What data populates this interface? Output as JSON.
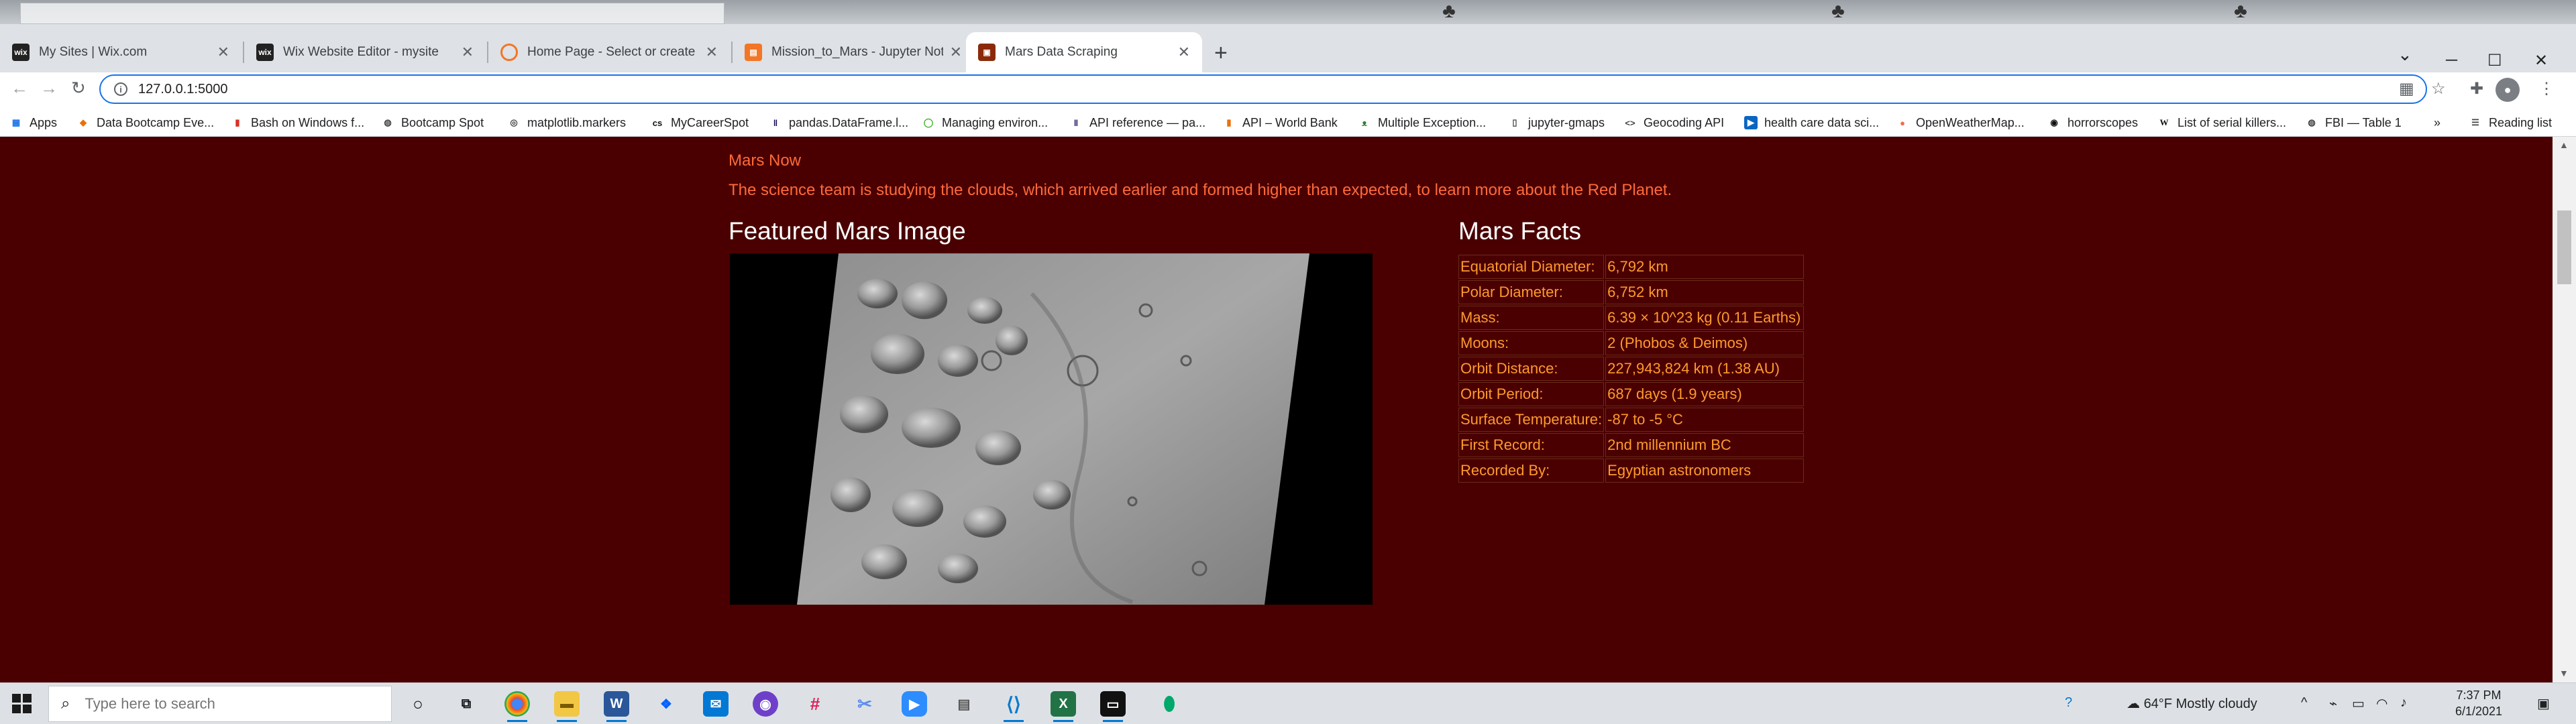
{
  "window": {
    "tabs": [
      {
        "label": "My Sites | Wix.com",
        "icon": "wix-icon"
      },
      {
        "label": "Wix Website Editor - mysite",
        "icon": "wix-icon"
      },
      {
        "label": "Home Page - Select or create a n",
        "icon": "jupyter-icon"
      },
      {
        "label": "Mission_to_Mars - Jupyter Notebo",
        "icon": "jupyter-notebook-icon"
      },
      {
        "label": "Mars Data Scraping",
        "icon": "mars-icon"
      }
    ],
    "new_tab": "+",
    "controls": {
      "minimize": "─",
      "maximize": "☐",
      "close": "✕"
    }
  },
  "address_bar": {
    "url": "127.0.0.1:5000"
  },
  "bookmarks": [
    {
      "label": "Apps"
    },
    {
      "label": "Data Bootcamp Eve..."
    },
    {
      "label": "Bash on Windows f..."
    },
    {
      "label": "Bootcamp Spot"
    },
    {
      "label": "matplotlib.markers"
    },
    {
      "label": "MyCareerSpot"
    },
    {
      "label": "pandas.DataFrame.l..."
    },
    {
      "label": "Managing environ..."
    },
    {
      "label": "API reference — pa..."
    },
    {
      "label": "API – World Bank"
    },
    {
      "label": "Multiple Exception..."
    },
    {
      "label": "jupyter-gmaps"
    },
    {
      "label": "Geocoding API"
    },
    {
      "label": "health care data sci..."
    },
    {
      "label": "OpenWeatherMap..."
    },
    {
      "label": "horrorscopes"
    },
    {
      "label": "List of serial killers..."
    },
    {
      "label": "FBI — Table 1"
    }
  ],
  "bookmarks_overflow": "»",
  "reading_list": "Reading list",
  "page": {
    "news_title": "Mars Now",
    "news_paragraph": "The science team is studying the clouds, which arrived earlier and formed higher than expected, to learn more about the Red Planet.",
    "featured_heading": "Featured Mars Image",
    "facts_heading": "Mars Facts",
    "facts": [
      {
        "label": "Equatorial Diameter:",
        "value": "6,792 km"
      },
      {
        "label": "Polar Diameter:",
        "value": "6,752 km"
      },
      {
        "label": "Mass:",
        "value": "6.39 × 10^23 kg (0.11 Earths)"
      },
      {
        "label": "Moons:",
        "value": "2 (Phobos & Deimos)"
      },
      {
        "label": "Orbit Distance:",
        "value": "227,943,824 km (1.38 AU)"
      },
      {
        "label": "Orbit Period:",
        "value": "687 days (1.9 years)"
      },
      {
        "label": "Surface Temperature:",
        "value": "-87 to -5 °C"
      },
      {
        "label": "First Record:",
        "value": "2nd millennium BC"
      },
      {
        "label": "Recorded By:",
        "value": "Egyptian astronomers"
      }
    ],
    "colors": {
      "background": "#4a0000",
      "news_text": "#ff6a3a",
      "facts_text": "#ff9a2e",
      "heading": "#ffffff"
    }
  },
  "taskbar": {
    "search_placeholder": "Type here to search",
    "weather": "64°F  Mostly cloudy",
    "time": "7:37 PM",
    "date": "6/1/2021"
  }
}
